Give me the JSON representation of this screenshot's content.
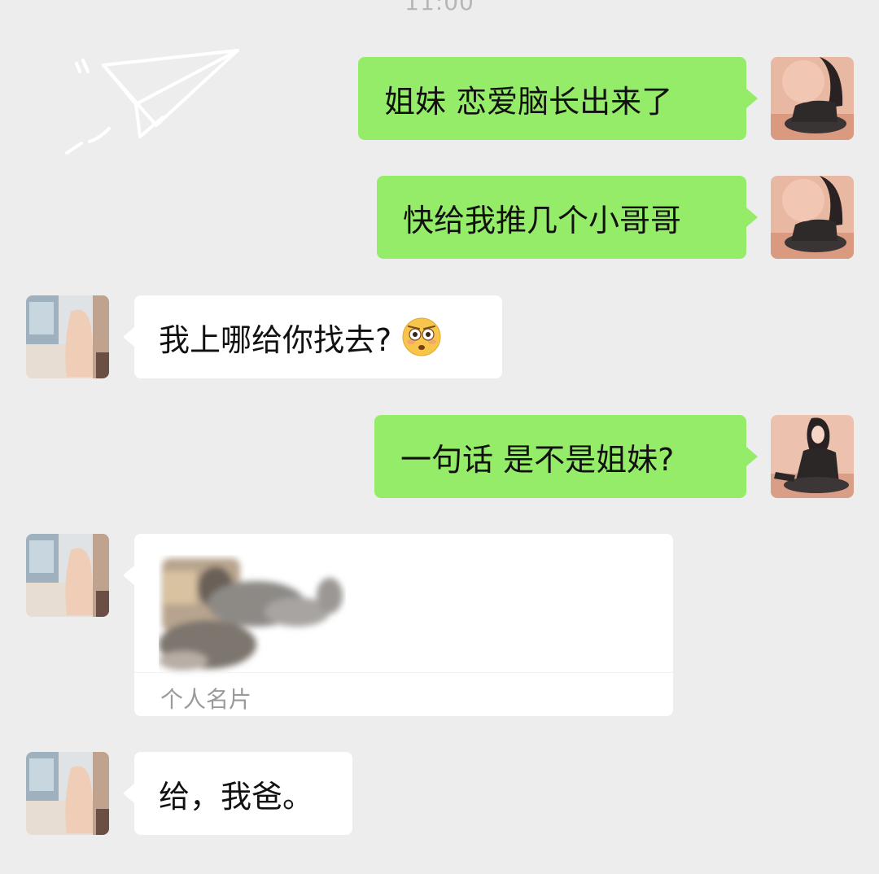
{
  "status": {
    "time": "11:00"
  },
  "messages": [
    {
      "side": "right",
      "text": "姐妹 恋爱脑长出来了"
    },
    {
      "side": "right",
      "text": "快给我推几个小哥哥"
    },
    {
      "side": "left",
      "text": "我上哪给你找去?",
      "emoji": "flushed-face-emoji"
    },
    {
      "side": "right",
      "text": "一句话 是不是姐妹?"
    },
    {
      "side": "left",
      "type": "contact-card",
      "card_label": "个人名片"
    },
    {
      "side": "left",
      "text": "给，我爸。"
    }
  ],
  "colors": {
    "background": "#ededed",
    "sent_bubble": "#95ec69",
    "received_bubble": "#ffffff"
  }
}
